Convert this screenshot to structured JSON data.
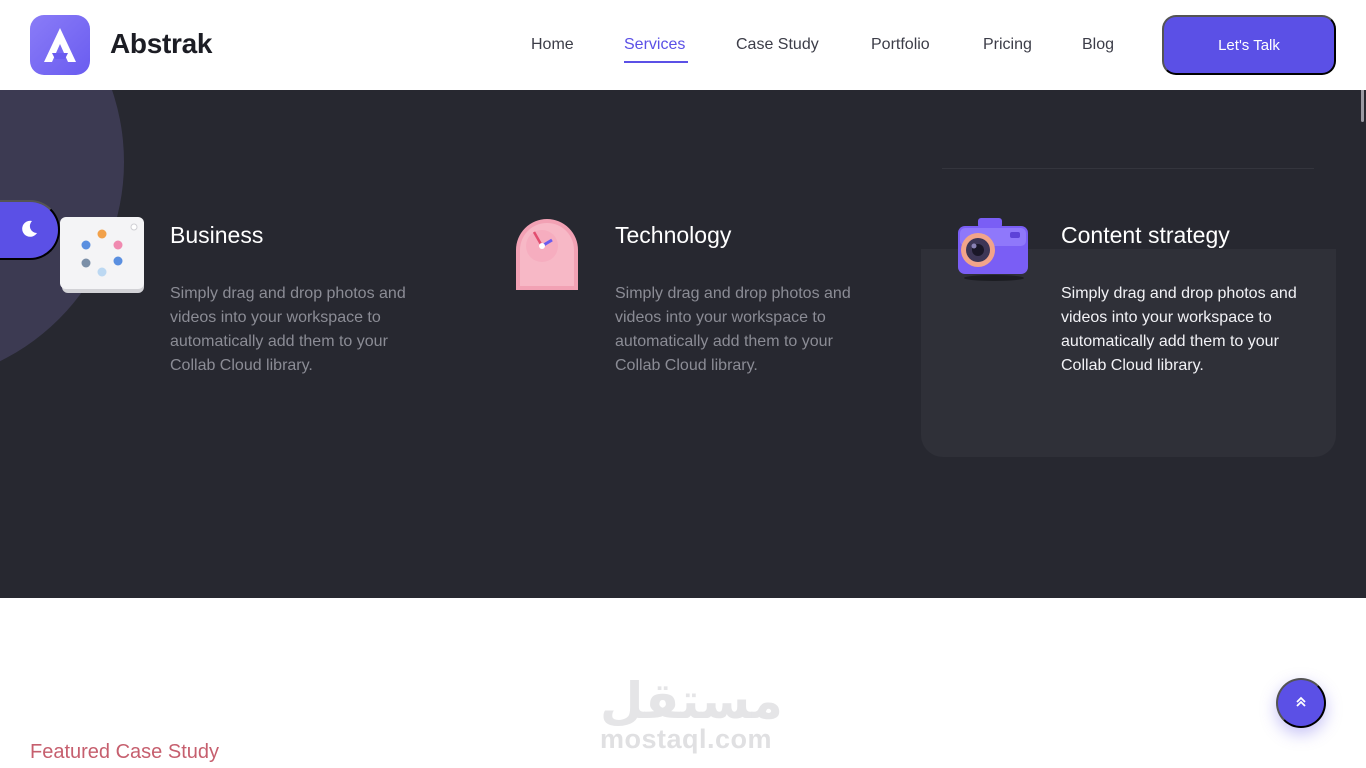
{
  "header": {
    "brand": "Abstrak",
    "nav": [
      {
        "label": "Home",
        "active": false
      },
      {
        "label": "Services",
        "active": true
      },
      {
        "label": "Case Study",
        "active": false
      },
      {
        "label": "Portfolio",
        "active": false
      },
      {
        "label": "Pricing",
        "active": false
      },
      {
        "label": "Blog",
        "active": false
      }
    ],
    "cta_label": "Let's Talk"
  },
  "services": [
    {
      "title": "Business",
      "description": "Simply drag and drop photos and videos into your workspace to automatically add them to your Collab Cloud library.",
      "icon": "calendar-dots-icon"
    },
    {
      "title": "Technology",
      "description": "Simply drag and drop photos and videos into your workspace to automatically add them to your Collab Cloud library.",
      "icon": "clock-icon"
    },
    {
      "title": "Content strategy",
      "description": "Simply drag and drop photos and videos into your workspace to automatically add them to your Collab Cloud library.",
      "icon": "camera-icon",
      "highlighted": true
    }
  ],
  "watermark": {
    "arabic": "مستقل",
    "latin": "mostaql.com"
  },
  "featured_label": "Featured Case Study",
  "icons": {
    "theme_toggle": "moon-icon",
    "scroll_top": "double-chevron-up-icon"
  },
  "colors": {
    "accent": "#5b50e6",
    "dark_bg": "#272830",
    "featured": "#c65f6e"
  }
}
